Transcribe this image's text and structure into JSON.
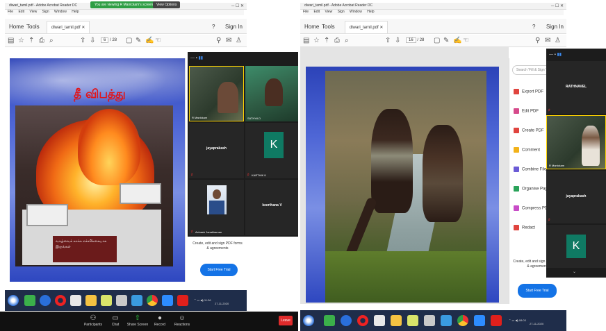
{
  "left": {
    "window_title": "diwari_tamil.pdf - Adobe Acrobat Reader DC",
    "menu": [
      "File",
      "Edit",
      "View",
      "Sign",
      "Window",
      "Help"
    ],
    "share_banner": "You are viewing R Manickam's screen",
    "view_options": "View Options",
    "tabs": {
      "home": "Home",
      "tools": "Tools",
      "doc": "diwari_tamil.pdf",
      "sign_in": "Sign In"
    },
    "page": {
      "current": "6",
      "total": "/ 28"
    },
    "slide_title": "தீ விபத்து",
    "fire_caption": "வாழ்வைக் காக்க எச்சரிக்கையாக இருங்கள்",
    "promo": "Create, edit and sign PDF forms & agreements",
    "trial_button": "Start Free Trial",
    "participants": [
      {
        "name": "R Manickam",
        "type": "video"
      },
      {
        "name": "SATHYA D",
        "type": "video"
      },
      {
        "name": "jayaprakash",
        "type": "name"
      },
      {
        "name": "KARTHIK K",
        "type": "avatar",
        "initial": "K"
      },
      {
        "name": "Avinash Janakiraman",
        "type": "photo"
      },
      {
        "name": "keerthana V",
        "type": "name"
      }
    ],
    "zoom_controls": [
      {
        "label": "Participants",
        "icon": "⚇",
        "count": "13"
      },
      {
        "label": "Chat",
        "icon": "▭"
      },
      {
        "label": "Share Screen",
        "icon": "⇧"
      },
      {
        "label": "Record",
        "icon": "●"
      },
      {
        "label": "Reactions",
        "icon": "☺"
      }
    ],
    "leave": "Leave",
    "clock": {
      "time": "11:36",
      "date": "27-11-2020"
    }
  },
  "right": {
    "window_title": "diwari_tamil.pdf - Adobe Acrobat Reader DC",
    "menu": [
      "File",
      "Edit",
      "View",
      "Sign",
      "Window",
      "Help"
    ],
    "tabs": {
      "home": "Home",
      "tools": "Tools",
      "doc": "diwari_tamil.pdf",
      "sign_in": "Sign In"
    },
    "page": {
      "current": "16",
      "total": "/ 28"
    },
    "search_placeholder": "Search 'Fill & Sign'",
    "panel_tools": [
      {
        "label": "Export PDF",
        "color": "#e0443e"
      },
      {
        "label": "Edit PDF",
        "color": "#d64a8b"
      },
      {
        "label": "Create PDF",
        "color": "#e0443e"
      },
      {
        "label": "Comment",
        "color": "#f2b21a"
      },
      {
        "label": "Combine Files",
        "color": "#6b5bd6"
      },
      {
        "label": "Organise Pages",
        "color": "#2aa35a"
      },
      {
        "label": "Compress PDF",
        "color": "#c84cc7"
      },
      {
        "label": "Redact",
        "color": "#e0443e"
      }
    ],
    "promo": "Create, edit and sign PDF forms & agreements",
    "trial_button": "Start Free Trial",
    "participants": [
      {
        "name": "RATHNAVEL",
        "type": "name"
      },
      {
        "name": "R Manickam",
        "type": "video"
      },
      {
        "name": "jayaprakash",
        "type": "name"
      },
      {
        "name": "K",
        "type": "avatar",
        "initial": "K"
      }
    ],
    "clock": {
      "time": "08:03",
      "date": "27-11-2020"
    }
  }
}
